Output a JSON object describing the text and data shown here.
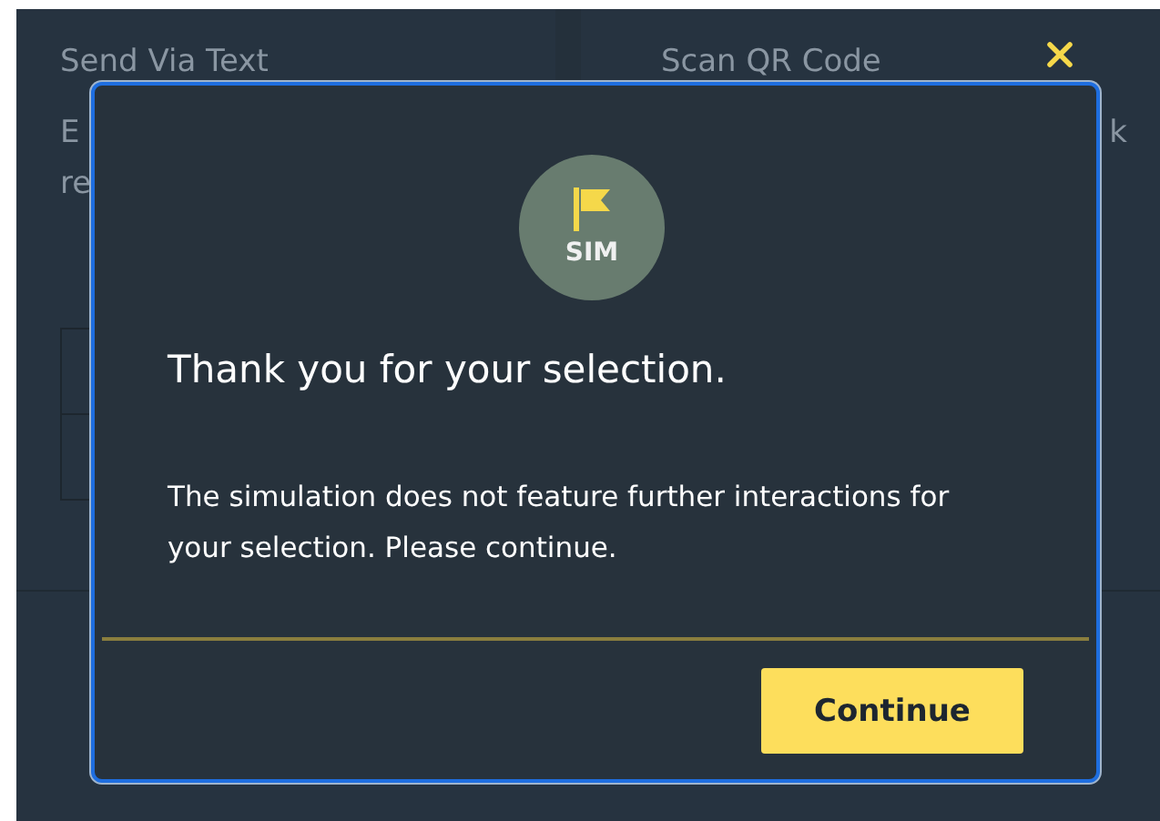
{
  "background": {
    "columns": [
      {
        "title": "Send Via Text",
        "fragments": [
          "E",
          "re"
        ]
      },
      {
        "title": "Scan QR Code",
        "fragments": [
          "k"
        ]
      }
    ]
  },
  "modal": {
    "badge": "SIM",
    "heading": "Thank you for your selection.",
    "message": "The simulation does not feature further interactions for your selection. Please continue.",
    "button": "Continue"
  }
}
